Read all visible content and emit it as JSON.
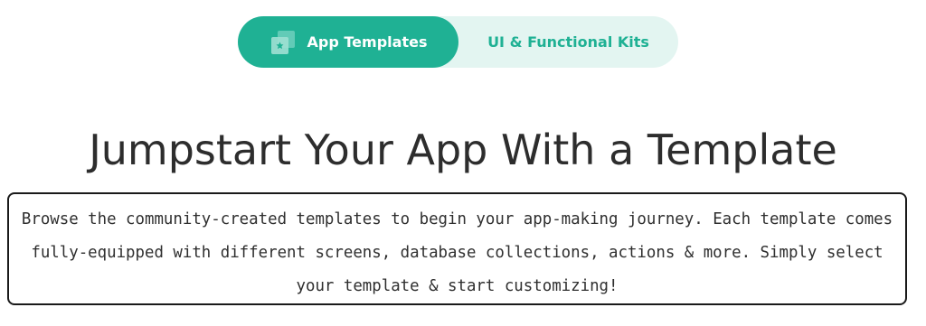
{
  "tabs": [
    {
      "label": "App Templates",
      "active": true,
      "icon": "templates-icon"
    },
    {
      "label": "UI & Functional Kits",
      "active": false
    }
  ],
  "heading": "Jumpstart Your App With a Template",
  "description": "Browse the community-created templates to begin your app-making journey. Each template comes fully-equipped with different screens, database collections, actions & more. Simply select your template & start customizing!",
  "colors": {
    "accent": "#1fb194",
    "tab_track": "#e3f5f1",
    "heading_text": "#2d2d2d",
    "body_text": "#2f2f2f"
  }
}
